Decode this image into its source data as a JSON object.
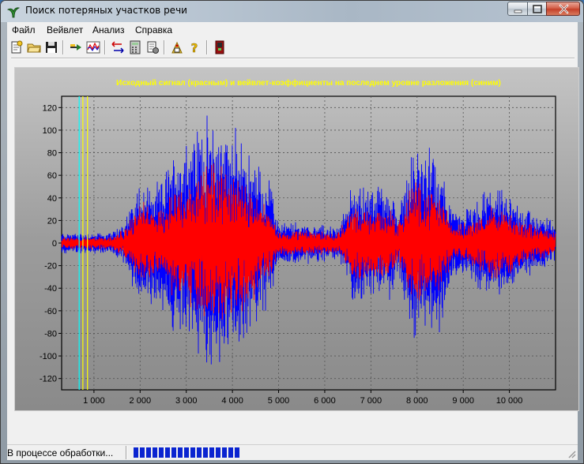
{
  "window": {
    "title": "Поиск потеряных участков речи"
  },
  "menu": {
    "items": [
      "Файл",
      "Вейвлет",
      "Анализ",
      "Справка"
    ]
  },
  "toolbar": {
    "icons": [
      "open-file-icon",
      "folder-icon",
      "save-icon",
      "wavelet-icon",
      "signal-plot-icon",
      "compare-icon",
      "calculator-icon",
      "document-settings-icon",
      "report-icon",
      "help-icon",
      "exit-icon"
    ]
  },
  "colors": {
    "signal": "#ff0000",
    "coefficients": "#0000ff",
    "title_text": "#ffff00",
    "marker_yellow": "#ffff00",
    "marker_cyan": "#00ffff",
    "progress": "#0a24d0"
  },
  "status": {
    "text": "В процессе обработки...",
    "progress_segments_filled": 17
  },
  "chart_data": {
    "type": "line",
    "title": "Исходный сигнал (красным) и вейвлет-коэффициенты на последнем уровне разложения (синим)",
    "xlabel": "",
    "ylabel": "",
    "xlim": [
      300,
      11000
    ],
    "ylim": [
      -130,
      130
    ],
    "x_ticks": [
      1000,
      2000,
      3000,
      4000,
      5000,
      6000,
      7000,
      8000,
      9000,
      10000
    ],
    "x_tick_labels": [
      "1 000",
      "2 000",
      "3 000",
      "4 000",
      "5 000",
      "6 000",
      "7 000",
      "8 000",
      "9 000",
      "10 000"
    ],
    "y_ticks": [
      -120,
      -100,
      -80,
      -60,
      -40,
      -20,
      0,
      20,
      40,
      60,
      80,
      100,
      120
    ],
    "y_tick_labels": [
      "-120",
      "-100",
      "-80",
      "-60",
      "-40",
      "-20",
      "0",
      "20",
      "40",
      "60",
      "80",
      "100",
      "120"
    ],
    "grid": true,
    "marker_lines": [
      {
        "x": 680,
        "color": "cyan"
      },
      {
        "x": 760,
        "color": "yellow"
      },
      {
        "x": 860,
        "color": "yellow"
      }
    ],
    "series": [
      {
        "color": "blue",
        "envelope_x": [
          300,
          1400,
          1700,
          2000,
          2400,
          2800,
          3200,
          3600,
          4000,
          4400,
          4800,
          5000,
          5600,
          6300,
          6600,
          7000,
          7400,
          7600,
          7900,
          8200,
          8500,
          8800,
          9200,
          9600,
          10000,
          10500,
          11000
        ],
        "envelope_y": [
          10,
          10,
          25,
          60,
          55,
          95,
          110,
          120,
          110,
          85,
          60,
          20,
          20,
          15,
          55,
          55,
          55,
          30,
          90,
          90,
          80,
          30,
          35,
          55,
          45,
          30,
          20
        ]
      },
      {
        "color": "red",
        "envelope_x": [
          300,
          1400,
          1700,
          2000,
          2400,
          2800,
          3200,
          3600,
          4000,
          4400,
          4800,
          5000,
          5600,
          6300,
          6600,
          7000,
          7400,
          7600,
          7900,
          8200,
          8500,
          8800,
          9200,
          9600,
          10000,
          10500,
          11000
        ],
        "envelope_y": [
          6,
          6,
          15,
          40,
          30,
          55,
          65,
          80,
          70,
          55,
          35,
          12,
          12,
          10,
          35,
          35,
          35,
          20,
          60,
          55,
          45,
          18,
          22,
          35,
          28,
          18,
          12
        ]
      }
    ]
  }
}
